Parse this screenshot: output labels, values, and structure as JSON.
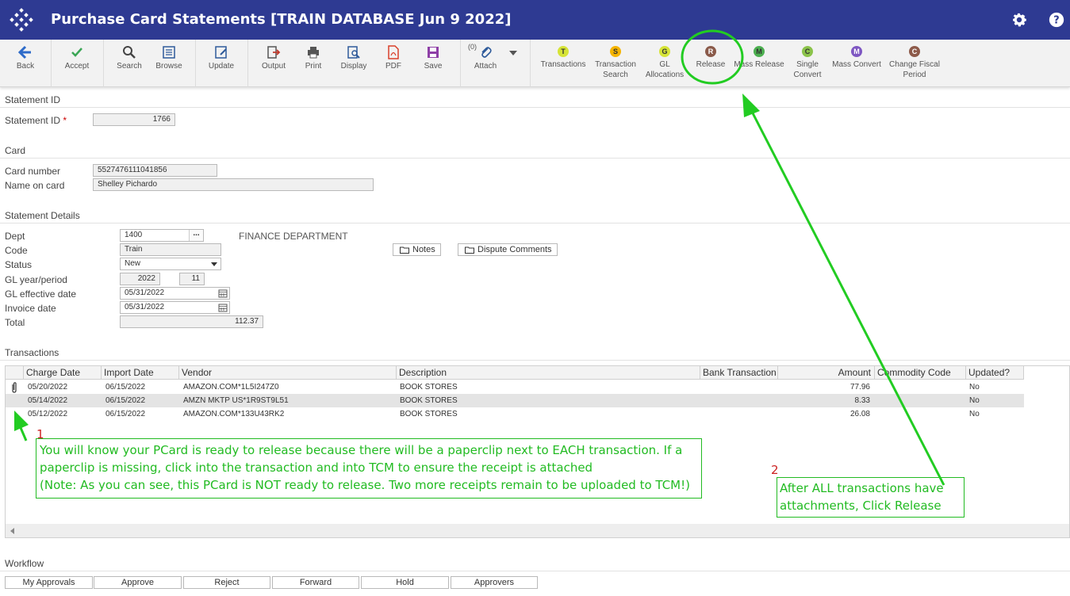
{
  "header": {
    "title": "Purchase Card Statements [TRAIN DATABASE Jun 9 2022]"
  },
  "toolbar": {
    "back": "Back",
    "accept": "Accept",
    "search": "Search",
    "browse": "Browse",
    "update": "Update",
    "output": "Output",
    "print": "Print",
    "display": "Display",
    "pdf": "PDF",
    "save": "Save",
    "attach_count": "(0)",
    "attach": "Attach",
    "actions": [
      {
        "letter": "T",
        "line1": "Transactions",
        "line2": "",
        "color": "#d6e436"
      },
      {
        "letter": "S",
        "line1": "Transaction",
        "line2": "Search",
        "color": "#f5b400"
      },
      {
        "letter": "G",
        "line1": "GL",
        "line2": "Allocations",
        "color": "#d6e436"
      },
      {
        "letter": "R",
        "line1": "Release",
        "line2": "",
        "color": "#8a5a4a"
      },
      {
        "letter": "M",
        "line1": "Mass Release",
        "line2": "",
        "color": "#4caf50"
      },
      {
        "letter": "C",
        "line1": "Single",
        "line2": "Convert",
        "color": "#8bc34a"
      },
      {
        "letter": "M",
        "line1": "Mass Convert",
        "line2": "",
        "color": "#7e57c2"
      },
      {
        "letter": "C",
        "line1": "Change Fiscal",
        "line2": "Period",
        "color": "#8d5a4a"
      }
    ]
  },
  "statement": {
    "section": "Statement ID",
    "id_label": "Statement ID",
    "required_mark": "*",
    "id_value": "1766"
  },
  "card": {
    "section": "Card",
    "number_label": "Card number",
    "number_value": "5527476111041856",
    "name_label": "Name on card",
    "name_value": "Shelley Pichardo"
  },
  "details": {
    "section": "Statement Details",
    "dept_label": "Dept",
    "dept_value": "1400",
    "dept_btn": "...",
    "dept_name": "FINANCE DEPARTMENT",
    "code_label": "Code",
    "code_value": "Train",
    "status_label": "Status",
    "status_value": "New",
    "gl_label": "GL year/period",
    "gl_year": "2022",
    "gl_period": "11",
    "gl_eff_label": "GL effective date",
    "gl_eff_value": "05/31/2022",
    "inv_label": "Invoice date",
    "inv_value": "05/31/2022",
    "total_label": "Total",
    "total_value": "112.37",
    "notes_btn": "Notes",
    "dispute_btn": "Dispute Comments"
  },
  "transactions": {
    "section": "Transactions",
    "columns": [
      "Charge Date",
      "Import Date",
      "Vendor",
      "Description",
      "Bank Transaction",
      "Amount",
      "Commodity Code",
      "Updated?"
    ],
    "rows": [
      {
        "charge": "05/20/2022",
        "import": "06/15/2022",
        "vendor": "AMAZON.COM*1L5I247Z0",
        "desc": "BOOK STORES",
        "bank": "",
        "amount": "77.96",
        "commodity": "",
        "updated": "No"
      },
      {
        "charge": "05/14/2022",
        "import": "06/15/2022",
        "vendor": "AMZN MKTP US*1R9ST9L51",
        "desc": "BOOK STORES",
        "bank": "",
        "amount": "8.33",
        "commodity": "",
        "updated": "No"
      },
      {
        "charge": "05/12/2022",
        "import": "06/15/2022",
        "vendor": "AMAZON.COM*133U43RK2",
        "desc": "BOOK STORES",
        "bank": "",
        "amount": "26.08",
        "commodity": "",
        "updated": "No"
      }
    ]
  },
  "workflow": {
    "section": "Workflow",
    "buttons": [
      "My Approvals",
      "Approve",
      "Reject",
      "Forward",
      "Hold",
      "Approvers"
    ]
  },
  "annotations": {
    "num1": "1",
    "note1_line1": "You will know your PCard is ready to release because there will be a paperclip next to EACH transaction. If a",
    "note1_line2": "paperclip is missing, click into the transaction and into TCM to ensure the receipt is attached",
    "note1_line3": "(Note: As you can see, this PCard is NOT ready to release. Two more receipts remain to be uploaded to TCM!)",
    "num2": "2",
    "note2_line1": "After ALL transactions have",
    "note2_line2": "attachments, Click Release",
    "annotation_color": "#22bb22"
  }
}
